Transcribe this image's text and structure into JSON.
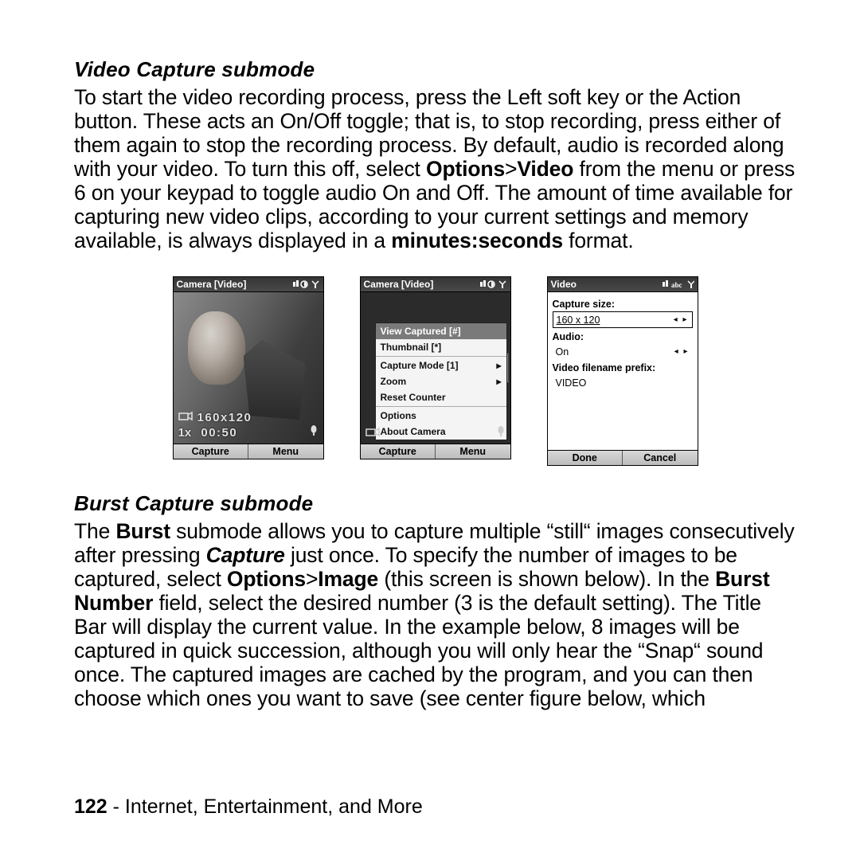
{
  "sec1_heading": "Video Capture submode",
  "sec2_heading": "Burst Capture submode",
  "para1": {
    "t1": "To start the video recording process, press the Left soft key or the Action button. These acts an On/Off toggle; that is, to stop recording, press either of them again to stop the recording process. By default, audio is recorded along with your video. To turn this off, select ",
    "b1": "Options",
    "gt1": ">",
    "b2": "Video",
    "t2": " from the menu or press 6 on your keypad to toggle audio On and Off. The amount of time available for capturing new video clips, according to your current settings and memory available, is always displayed in a ",
    "b3": "minutes:seconds",
    "t3": " for­mat."
  },
  "para2": {
    "t1": "The ",
    "b1": "Burst",
    "t2": " submode allows you to capture multiple “still“ images consecutively after pressing ",
    "bi1": "Capture",
    "t3": " just once. To specify the number of images to be captured, select ",
    "b2": "Options",
    "gt": ">",
    "b3": "Image",
    "t4": " (this screen is shown below). In the ",
    "b4": "Burst Number",
    "t5": " field, select the desired number (3 is the default setting). The Title Bar will display the current value. In the example below, 8 images will be captured in quick succession, although you will only hear the “Snap“ sound once. The captured images are cached by the program, and you can then choose which ones you want to save (see center figure below, which"
  },
  "footer": {
    "page": "122",
    "section": " - Internet, Entertainment, and More"
  },
  "fig1": {
    "title": "Camera [Video]",
    "res": "160x120",
    "zoom": "1x",
    "time": "00:50",
    "left": "Capture",
    "right": "Menu"
  },
  "fig2": {
    "title": "Camera [Video]",
    "left": "Capture",
    "right": "Menu",
    "menu": [
      "View Captured [#]",
      "Thumbnail [*]",
      "Capture Mode [1]",
      "Zoom",
      "Reset Counter",
      "Options",
      "About Camera"
    ]
  },
  "fig3": {
    "title": "Video",
    "labels": {
      "size": "Capture size:",
      "audio": "Audio:",
      "prefix": "Video filename prefix:"
    },
    "values": {
      "size": "160 x 120",
      "audio": "On",
      "prefix": "VIDEO"
    },
    "left": "Done",
    "right": "Cancel"
  }
}
